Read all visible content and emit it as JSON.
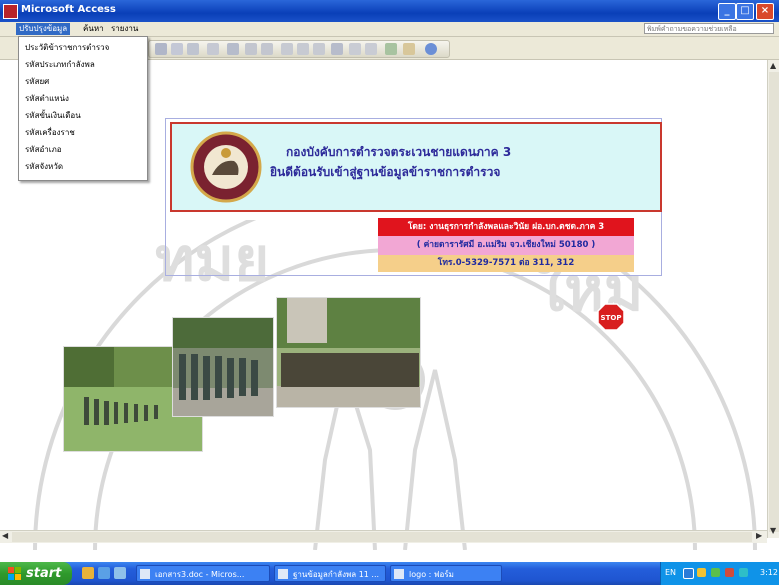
{
  "window": {
    "title": "Microsoft Access"
  },
  "menubar": {
    "items": [
      "ปรับปรุงข้อมูล",
      "ค้นหา",
      "รายงาน"
    ],
    "help_placeholder": "พิมพ์คำถามขอความช่วยเหลือ"
  },
  "dropdown": {
    "items": [
      "ประวัติข้าราชการตำรวจ",
      "รหัสประเภทกำลังพล",
      "รหัสยศ",
      "รหัสตำแหน่ง",
      "รหัสขั้นเงินเดือน",
      "รหัสเครื่องราช",
      "รหัสอำเภอ",
      "รหัสจังหวัด"
    ]
  },
  "banner": {
    "line1": "กองบังคับการตำรวจตระเวนชายแดนภาค 3",
    "line2": "ยินดีต้อนรับเข้าสู่ฐานข้อมูลข้าราชการตำรวจ"
  },
  "credits": {
    "line1": "โดย: งานธุรการกำลังพลและวินัย ฝอ.บก.ตชด.ภาค 3",
    "line2": "( ค่ายดารารัศมี อ.แม่ริม จว.เชียงใหม่ 50180 )",
    "line3": "โทร.0-5329-7571 ต่อ 311, 312"
  },
  "stop_button": {
    "label": "STOP"
  },
  "taskbar": {
    "start_label": "start",
    "tasks": [
      "เอกสาร3.doc - Micros...",
      "ฐานข้อมูลกำลังพล 11 ...",
      "logo : ฟอร์ม"
    ],
    "language": "EN",
    "clock": "3:12"
  },
  "colors": {
    "banner_bg": "#d9f7f7",
    "banner_border": "#c9382e",
    "banner_text": "#2d2a9a",
    "credit_red": "#e0141d",
    "credit_pink": "#f2a7d4",
    "credit_orange": "#f5cf8a"
  }
}
